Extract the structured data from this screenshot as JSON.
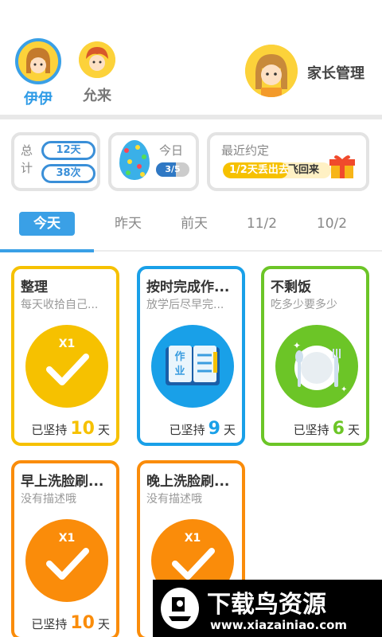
{
  "colors": {
    "accent": "#3aa0e6",
    "yellow": "#f6c100",
    "blue": "#19a0e8",
    "green": "#6cc527",
    "orange": "#fa8c0a"
  },
  "header": {
    "children": [
      {
        "name": "伊伊",
        "selected": true
      },
      {
        "name": "允来",
        "selected": false
      }
    ],
    "parent_label": "家长管理"
  },
  "stats": {
    "total": {
      "label": "总计",
      "days": "12天",
      "times": "38次"
    },
    "today": {
      "label": "今日",
      "progress_text": "3/5",
      "progress": 0.6
    },
    "promise": {
      "label": "最近约定",
      "text_a": "1/2天丢出去",
      "text_b": "飞回来",
      "progress": 0.6
    }
  },
  "tabs": [
    {
      "label": "今天",
      "active": true
    },
    {
      "label": "昨天",
      "active": false
    },
    {
      "label": "前天",
      "active": false
    },
    {
      "label": "11/2",
      "active": false
    },
    {
      "label": "10/2",
      "active": false
    }
  ],
  "cards": [
    {
      "title": "整理",
      "desc": "每天收拾自己...",
      "badge": "X1",
      "icon": "check-icon",
      "streak_prefix": "已坚持",
      "streak": "10",
      "streak_suffix": "天",
      "color": "#f6c100"
    },
    {
      "title": "按时完成作...",
      "desc": "放学后尽早完...",
      "icon": "homework-book-icon",
      "streak_prefix": "已坚持",
      "streak": "9",
      "streak_suffix": "天",
      "color": "#19a0e8"
    },
    {
      "title": "不剩饭",
      "desc": "吃多少要多少",
      "icon": "plate-cutlery-icon",
      "streak_prefix": "已坚持",
      "streak": "6",
      "streak_suffix": "天",
      "color": "#6cc527"
    },
    {
      "title": "早上洗脸刷...",
      "desc": "没有描述哦",
      "badge": "X1",
      "icon": "check-icon",
      "streak_prefix": "已坚持",
      "streak": "10",
      "streak_suffix": "天",
      "color": "#fa8c0a"
    },
    {
      "title": "晚上洗脸刷...",
      "desc": "没有描述哦",
      "badge": "X1",
      "icon": "check-icon",
      "color": "#fa8c0a"
    }
  ],
  "watermark": {
    "title": "下载鸟资源",
    "url": "www.xiazainiao.com"
  }
}
